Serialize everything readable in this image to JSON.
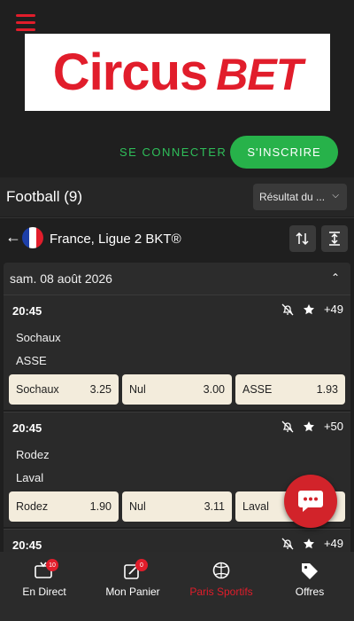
{
  "brand": {
    "logo_part1": "Circus",
    "logo_part2": "BET"
  },
  "auth": {
    "connect_label": "SE CONNECTER",
    "register_label": "S'INSCRIRE"
  },
  "section": {
    "title": "Football (9)",
    "sort_label": "Résultat du ..."
  },
  "league": {
    "name": "France, Ligue 2 BKT®"
  },
  "date_group": {
    "label": "sam. 08 août 2026"
  },
  "matches": [
    {
      "time": "20:45",
      "more": "+49",
      "home": "Sochaux",
      "away": "ASSE",
      "odds": [
        {
          "label": "Sochaux",
          "value": "3.25"
        },
        {
          "label": "Nul",
          "value": "3.00"
        },
        {
          "label": "ASSE",
          "value": "1.93"
        }
      ]
    },
    {
      "time": "20:45",
      "more": "+50",
      "home": "Rodez",
      "away": "Laval",
      "odds": [
        {
          "label": "Rodez",
          "value": "1.90"
        },
        {
          "label": "Nul",
          "value": "3.11"
        },
        {
          "label": "Laval",
          "value": ""
        }
      ]
    },
    {
      "time": "20:45",
      "more": "+49"
    }
  ],
  "nav": [
    {
      "label": "En Direct",
      "icon": "live-tv-icon",
      "badge": "10"
    },
    {
      "label": "Mon Panier",
      "icon": "cart-edit-icon",
      "badge": "0"
    },
    {
      "label": "Paris Sportifs",
      "icon": "sport-ball-icon",
      "active": true
    },
    {
      "label": "Offres",
      "icon": "offer-tag-icon"
    }
  ],
  "colors": {
    "brand_red": "#e11d2b",
    "green": "#27b24a",
    "odd_bg": "#f3ecdc"
  }
}
